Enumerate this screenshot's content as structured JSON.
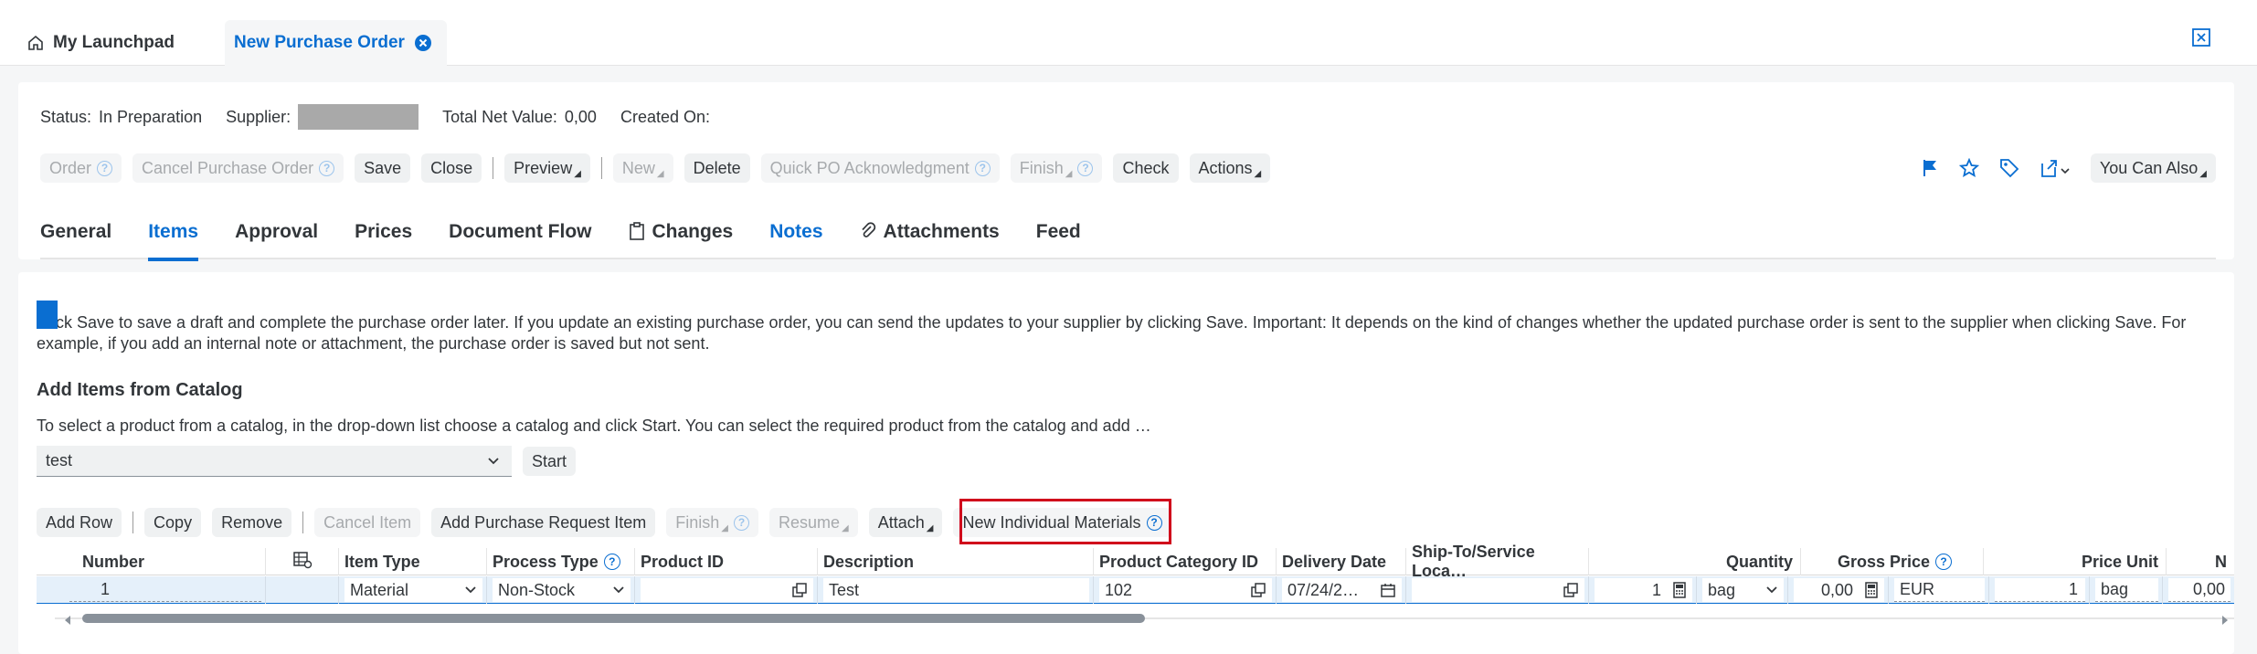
{
  "shell": {
    "tabs": [
      {
        "label": "My Launchpad",
        "icon": "home-icon"
      },
      {
        "label": "New Purchase Order",
        "icon": "close-circle-icon"
      }
    ],
    "right_icon": "close-window-icon"
  },
  "header": {
    "status_label": "Status:",
    "status_value": "In Preparation",
    "supplier_label": "Supplier:",
    "total_label": "Total Net Value:",
    "total_value": "0,00",
    "created_label": "Created On:"
  },
  "toolbar": {
    "order": "Order",
    "cancel_po": "Cancel Purchase Order",
    "save": "Save",
    "close": "Close",
    "preview": "Preview",
    "new": "New",
    "delete": "Delete",
    "quick_po": "Quick PO Acknowledgment",
    "finish": "Finish",
    "check": "Check",
    "actions": "Actions",
    "you_can_also": "You Can Also",
    "right_icons": [
      "flag-icon",
      "star-icon",
      "tag-icon",
      "share-icon"
    ]
  },
  "tabs": [
    {
      "label": "General"
    },
    {
      "label": "Items"
    },
    {
      "label": "Approval"
    },
    {
      "label": "Prices"
    },
    {
      "label": "Document Flow"
    },
    {
      "label": "Changes",
      "icon": "clipboard-icon"
    },
    {
      "label": "Notes"
    },
    {
      "label": "Attachments",
      "icon": "paperclip-icon"
    },
    {
      "label": "Feed"
    }
  ],
  "content": {
    "info_text": "Click Save to save a draft and complete the purchase order later. If you update an existing purchase order, you can send the updates to your supplier by clicking Save. Important: It depends on the kind of changes whether the updated purchase order is sent to the supplier when clicking Save. For example, if you add an internal note or attachment, the purchase order is saved but not sent.",
    "catalog_title": "Add Items from Catalog",
    "catalog_hint": "To select a product from a catalog, in the drop-down list choose a catalog and click Start. You can select the required product from the catalog and add …",
    "catalog_value": "test",
    "start": "Start"
  },
  "items_toolbar": {
    "add_row": "Add Row",
    "copy": "Copy",
    "remove": "Remove",
    "cancel_item": "Cancel Item",
    "add_pr_item": "Add Purchase Request Item",
    "finish": "Finish",
    "resume": "Resume",
    "attach": "Attach",
    "new_individual_materials": "New Individual Materials"
  },
  "table": {
    "headers": {
      "number": "Number",
      "item_type": "Item Type",
      "process_type": "Process Type",
      "product_id": "Product ID",
      "description": "Description",
      "product_category": "Product Category ID",
      "delivery_date": "Delivery Date",
      "ship_to": "Ship-To/Service Loca…",
      "quantity": "Quantity",
      "gross_price": "Gross Price",
      "price_unit": "Price Unit",
      "next": "N"
    },
    "row": {
      "number": "1",
      "item_type": "Material",
      "process_type": "Non-Stock",
      "product_id": "",
      "description": "Test",
      "product_category": "102",
      "delivery_date": "07/24/2…",
      "ship_to": "",
      "quantity": "1",
      "unit": "bag",
      "gross_price": "0,00",
      "currency": "EUR",
      "price_unit": "1",
      "price_unit_uom": "bag",
      "net": "0,00"
    }
  },
  "colors": {
    "accent": "#0a6ed1",
    "highlight": "#d0021b"
  }
}
